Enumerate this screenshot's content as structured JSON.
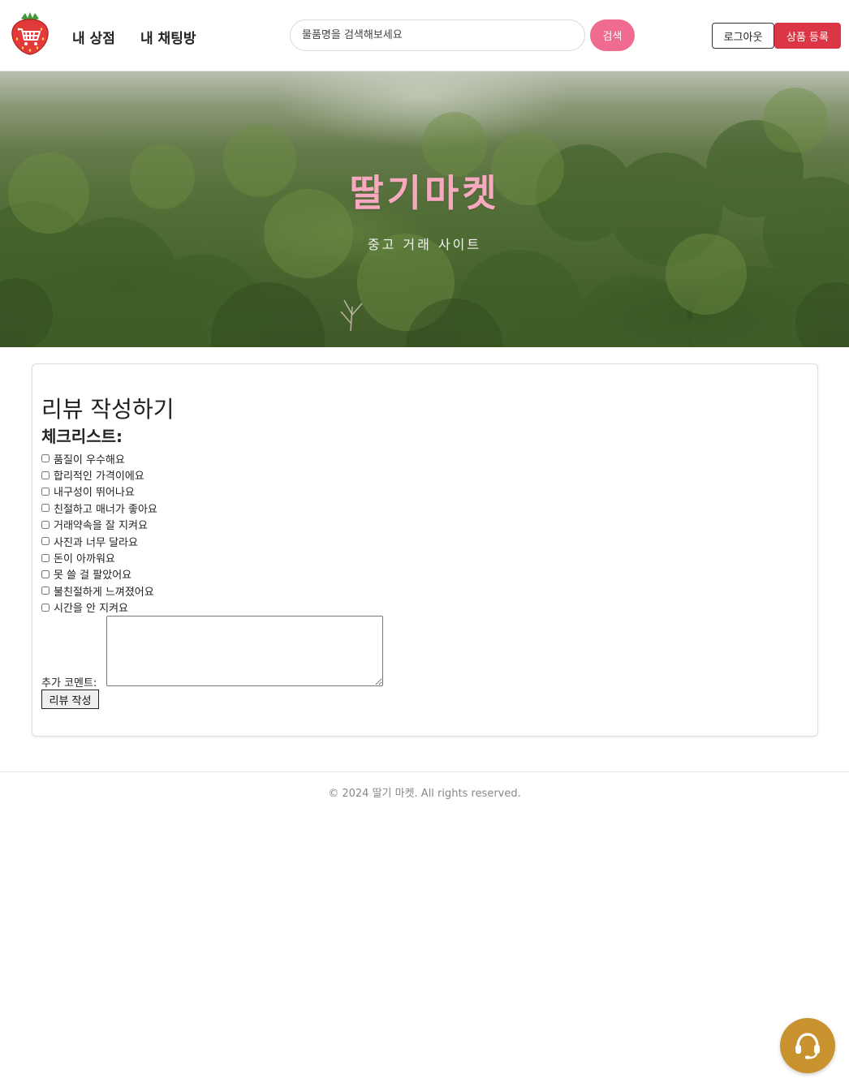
{
  "header": {
    "logo_icon": "strawberry-cart-icon",
    "nav": [
      {
        "label": "내 상점"
      },
      {
        "label": "내 채팅방"
      }
    ],
    "search": {
      "value": "",
      "placeholder": "물품명을 검색해보세요",
      "button_label": "검색"
    },
    "logout_label": "로그아웃",
    "register_label": "상품 등록"
  },
  "hero": {
    "title": "딸기마켓",
    "subtitle": "중고 거래 사이트"
  },
  "review": {
    "title": "리뷰 작성하기",
    "checklist_heading": "체크리스트:",
    "checklist": [
      "품질이 우수해요",
      "합리적인 가격이에요",
      "내구성이 뛰어나요",
      "친절하고 매너가 좋아요",
      "거래약속을 잘 지켜요",
      "사진과 너무 달라요",
      "돈이 아까워요",
      "못 쓸 걸 팔았어요",
      "불친절하게 느껴졌어요",
      "시간을 안 지켜요"
    ],
    "comment_label": "추가 코멘트:",
    "comment_value": "",
    "submit_label": "리뷰 작성"
  },
  "footer": {
    "copyright": "© 2024 딸기 마켓. All rights reserved."
  },
  "support": {
    "icon": "headset-icon"
  },
  "colors": {
    "search_button": "#ef6b8f",
    "register_button": "#dc3545",
    "hero_title": "#f7a9bf",
    "support_button": "#c8932f"
  }
}
